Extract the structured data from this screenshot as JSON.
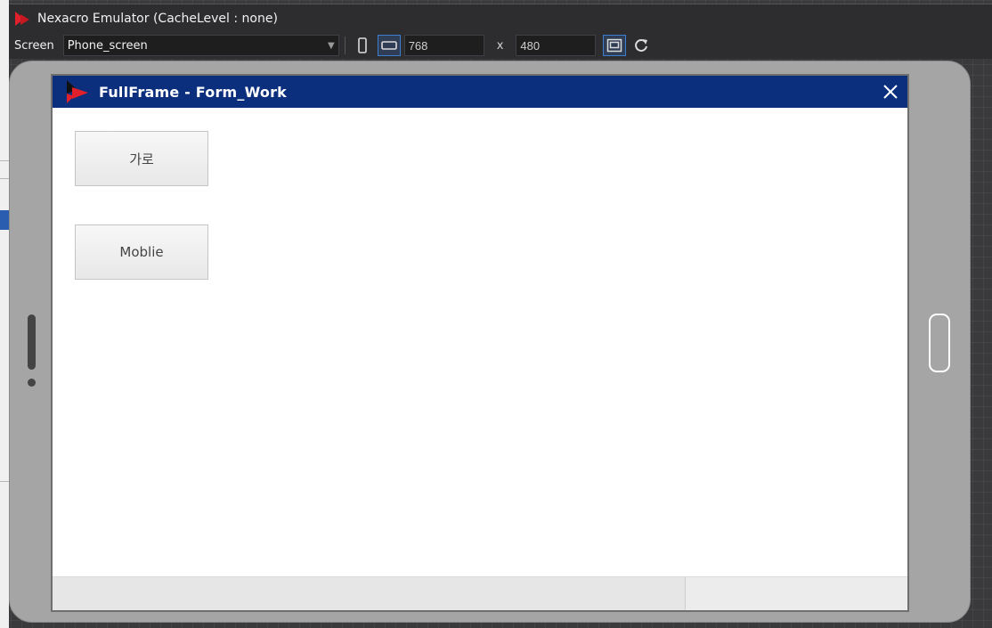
{
  "window": {
    "title": "Nexacro Emulator (CacheLevel : none)"
  },
  "toolbar": {
    "screen_label": "Screen",
    "screen_value": "Phone_screen",
    "width_value": "768",
    "times_label": "x",
    "height_value": "480",
    "icons": [
      "portrait-icon",
      "landscape-icon",
      "fit-screen-icon",
      "refresh-icon"
    ]
  },
  "frame": {
    "title": "FullFrame - Form_Work"
  },
  "form": {
    "buttons": [
      "가로",
      "Moblie"
    ]
  },
  "colors": {
    "frame_title_bg": "#0b2f7d",
    "logo_red": "#e0202a",
    "device_body": "#a5a5a5",
    "active_toggle": "#3c7fd1"
  }
}
